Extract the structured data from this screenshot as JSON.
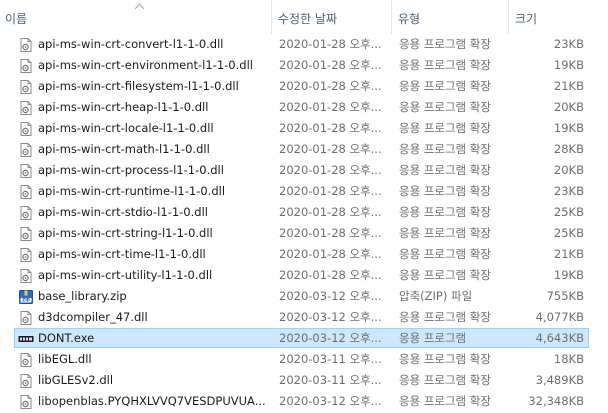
{
  "columns": {
    "name": "이름",
    "date": "수정한 날짜",
    "type": "유형",
    "size": "크기"
  },
  "files": [
    {
      "name": "api-ms-win-crt-convert-l1-1-0.dll",
      "date": "2020-01-28 오후...",
      "type": "응용 프로그램 확장",
      "size": "23KB",
      "icon": "dll-file-icon"
    },
    {
      "name": "api-ms-win-crt-environment-l1-1-0.dll",
      "date": "2020-01-28 오후...",
      "type": "응용 프로그램 확장",
      "size": "19KB",
      "icon": "dll-file-icon"
    },
    {
      "name": "api-ms-win-crt-filesystem-l1-1-0.dll",
      "date": "2020-01-28 오후...",
      "type": "응용 프로그램 확장",
      "size": "21KB",
      "icon": "dll-file-icon"
    },
    {
      "name": "api-ms-win-crt-heap-l1-1-0.dll",
      "date": "2020-01-28 오후...",
      "type": "응용 프로그램 확장",
      "size": "20KB",
      "icon": "dll-file-icon"
    },
    {
      "name": "api-ms-win-crt-locale-l1-1-0.dll",
      "date": "2020-01-28 오후...",
      "type": "응용 프로그램 확장",
      "size": "19KB",
      "icon": "dll-file-icon"
    },
    {
      "name": "api-ms-win-crt-math-l1-1-0.dll",
      "date": "2020-01-28 오후...",
      "type": "응용 프로그램 확장",
      "size": "28KB",
      "icon": "dll-file-icon"
    },
    {
      "name": "api-ms-win-crt-process-l1-1-0.dll",
      "date": "2020-01-28 오후...",
      "type": "응용 프로그램 확장",
      "size": "20KB",
      "icon": "dll-file-icon"
    },
    {
      "name": "api-ms-win-crt-runtime-l1-1-0.dll",
      "date": "2020-01-28 오후...",
      "type": "응용 프로그램 확장",
      "size": "23KB",
      "icon": "dll-file-icon"
    },
    {
      "name": "api-ms-win-crt-stdio-l1-1-0.dll",
      "date": "2020-01-28 오후...",
      "type": "응용 프로그램 확장",
      "size": "25KB",
      "icon": "dll-file-icon"
    },
    {
      "name": "api-ms-win-crt-string-l1-1-0.dll",
      "date": "2020-01-28 오후...",
      "type": "응용 프로그램 확장",
      "size": "25KB",
      "icon": "dll-file-icon"
    },
    {
      "name": "api-ms-win-crt-time-l1-1-0.dll",
      "date": "2020-01-28 오후...",
      "type": "응용 프로그램 확장",
      "size": "21KB",
      "icon": "dll-file-icon"
    },
    {
      "name": "api-ms-win-crt-utility-l1-1-0.dll",
      "date": "2020-01-28 오후...",
      "type": "응용 프로그램 확장",
      "size": "19KB",
      "icon": "dll-file-icon"
    },
    {
      "name": "base_library.zip",
      "date": "2020-03-12 오후...",
      "type": "압축(ZIP) 파일",
      "size": "755KB",
      "icon": "zip-file-icon"
    },
    {
      "name": "d3dcompiler_47.dll",
      "date": "2020-03-12 오후...",
      "type": "응용 프로그램 확장",
      "size": "4,077KB",
      "icon": "dll-file-icon"
    },
    {
      "name": "DONT.exe",
      "date": "2020-03-12 오후...",
      "type": "응용 프로그램",
      "size": "4,643KB",
      "icon": "exe-file-icon",
      "selected": true
    },
    {
      "name": "libEGL.dll",
      "date": "2020-03-11 오후...",
      "type": "응용 프로그램 확장",
      "size": "18KB",
      "icon": "dll-file-icon"
    },
    {
      "name": "libGLESv2.dll",
      "date": "2020-03-11 오후...",
      "type": "응용 프로그램 확장",
      "size": "3,489KB",
      "icon": "dll-file-icon"
    },
    {
      "name": "libopenblas.PYQHXLVVQ7VESDPUVUA...",
      "date": "2020-03-12 오후...",
      "type": "응용 프로그램 확장",
      "size": "32,348KB",
      "icon": "dll-file-icon"
    }
  ]
}
